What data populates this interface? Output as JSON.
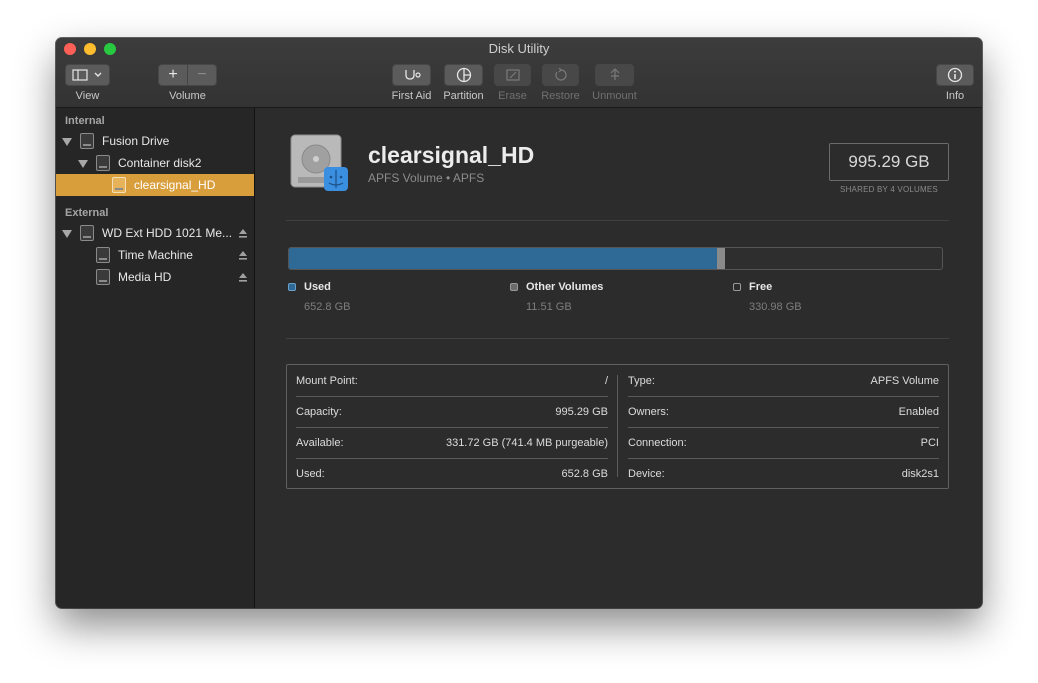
{
  "window": {
    "title": "Disk Utility"
  },
  "toolbar": {
    "view_label": "View",
    "volume_label": "Volume",
    "first_aid_label": "First Aid",
    "partition_label": "Partition",
    "erase_label": "Erase",
    "restore_label": "Restore",
    "unmount_label": "Unmount",
    "info_label": "Info",
    "add_glyph": "+",
    "remove_glyph": "−"
  },
  "sidebar": {
    "internal_header": "Internal",
    "external_header": "External",
    "items": [
      {
        "label": "Fusion Drive",
        "icon": "internal-disk-icon"
      },
      {
        "label": "Container disk2",
        "icon": "container-disk-icon"
      },
      {
        "label": "clearsignal_HD",
        "icon": "volume-icon",
        "selected": true
      },
      {
        "label": "WD Ext HDD 1021 Me...",
        "icon": "external-disk-icon"
      },
      {
        "label": "Time Machine",
        "icon": "external-volume-icon"
      },
      {
        "label": "Media HD",
        "icon": "external-volume-icon"
      }
    ]
  },
  "volume": {
    "name": "clearsignal_HD",
    "subtitle": "APFS Volume • APFS",
    "size": "995.29 GB",
    "size_caption": "SHARED BY 4 VOLUMES"
  },
  "usage": {
    "used_fraction": 0.6559,
    "other_fraction": 0.0116,
    "colors": {
      "used": "#2f6a97",
      "other": "#8a8a8a",
      "free": "#2e2e2e"
    },
    "legend": [
      {
        "name": "Used",
        "value": "652.8 GB"
      },
      {
        "name": "Other Volumes",
        "value": "11.51 GB"
      },
      {
        "name": "Free",
        "value": "330.98 GB"
      }
    ]
  },
  "info": {
    "left": [
      {
        "key": "Mount Point:",
        "value": "/"
      },
      {
        "key": "Capacity:",
        "value": "995.29 GB"
      },
      {
        "key": "Available:",
        "value": "331.72 GB (741.4 MB purgeable)"
      },
      {
        "key": "Used:",
        "value": "652.8 GB"
      }
    ],
    "right": [
      {
        "key": "Type:",
        "value": "APFS Volume"
      },
      {
        "key": "Owners:",
        "value": "Enabled"
      },
      {
        "key": "Connection:",
        "value": "PCI"
      },
      {
        "key": "Device:",
        "value": "disk2s1"
      }
    ]
  }
}
